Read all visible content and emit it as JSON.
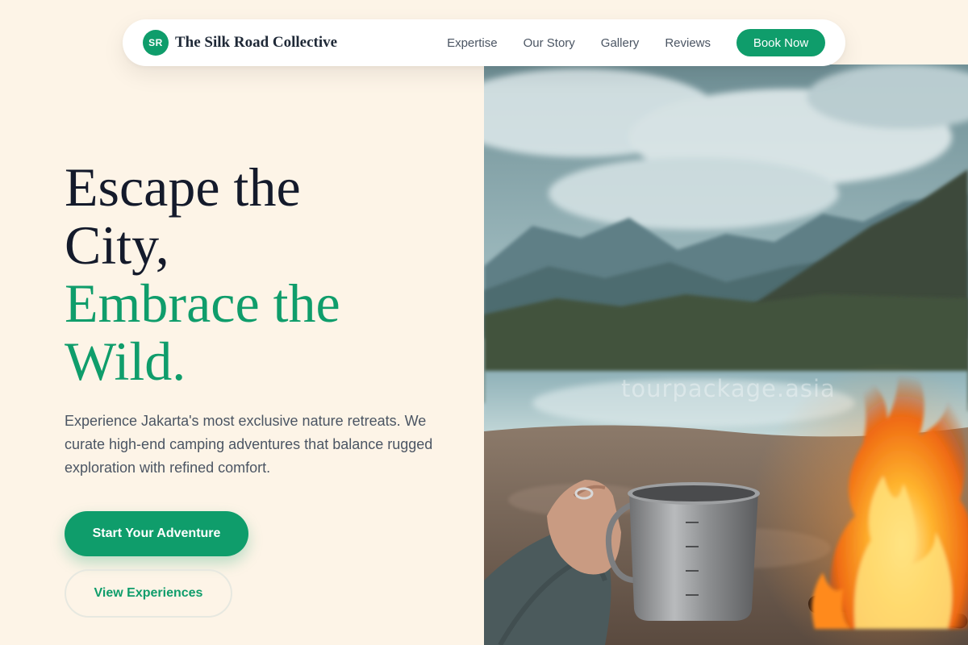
{
  "brand": {
    "logo_initials": "SR",
    "name": "The Silk Road Collective",
    "accent_color": "#0f9d6b"
  },
  "nav": {
    "links": [
      "Expertise",
      "Our Story",
      "Gallery",
      "Reviews"
    ],
    "cta_label": "Book Now"
  },
  "hero": {
    "headline_line1": "Escape the",
    "headline_line2": "City,",
    "headline_line3": "Embrace the",
    "headline_line4": "Wild.",
    "description": "Experience Jakarta's most exclusive nature retreats. We curate high-end camping adventures that balance rugged exploration with refined comfort.",
    "primary_button": "Start Your Adventure",
    "secondary_button": "View Experiences"
  },
  "image": {
    "watermark": "tourpackage.asia",
    "subject": "hand holding steel camping mug beside campfire at mountain lake"
  }
}
